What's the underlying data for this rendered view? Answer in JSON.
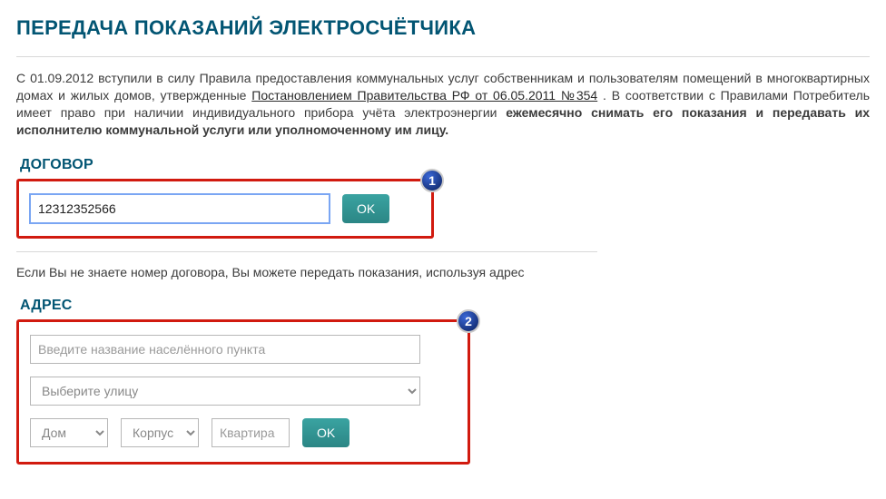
{
  "title": "ПЕРЕДАЧА ПОКАЗАНИЙ ЭЛЕКТРОСЧЁТЧИКА",
  "intro": {
    "t1": "С 01.09.2012 вступили в силу Правила предоставления коммунальных услуг собственникам и пользователям помещений в многоквартирных домах и жилых домов, утвержденные ",
    "link": "Постановлением Правительства РФ от 06.05.2011 №354",
    "t2": ". В соответствии с Правилами Потребитель имеет право при наличии индивидуального прибора учёта электроэнергии ",
    "bold": "ежемесячно снимать его показания и передавать их исполнителю коммунальной услуги или уполномоченному им лицу."
  },
  "contract": {
    "label": "ДОГОВОР",
    "value": "12312352566",
    "ok": "OK",
    "badge": "1"
  },
  "help_text": "Если Вы не знаете номер договора, Вы можете передать показания, используя адрес",
  "address": {
    "label": "АДРЕС",
    "locality_ph": "Введите название населённого пункта",
    "street_ph": "Выберите улицу",
    "house_ph": "Дом",
    "building_ph": "Корпус",
    "flat_ph": "Квартира",
    "ok": "OK",
    "badge": "2"
  }
}
